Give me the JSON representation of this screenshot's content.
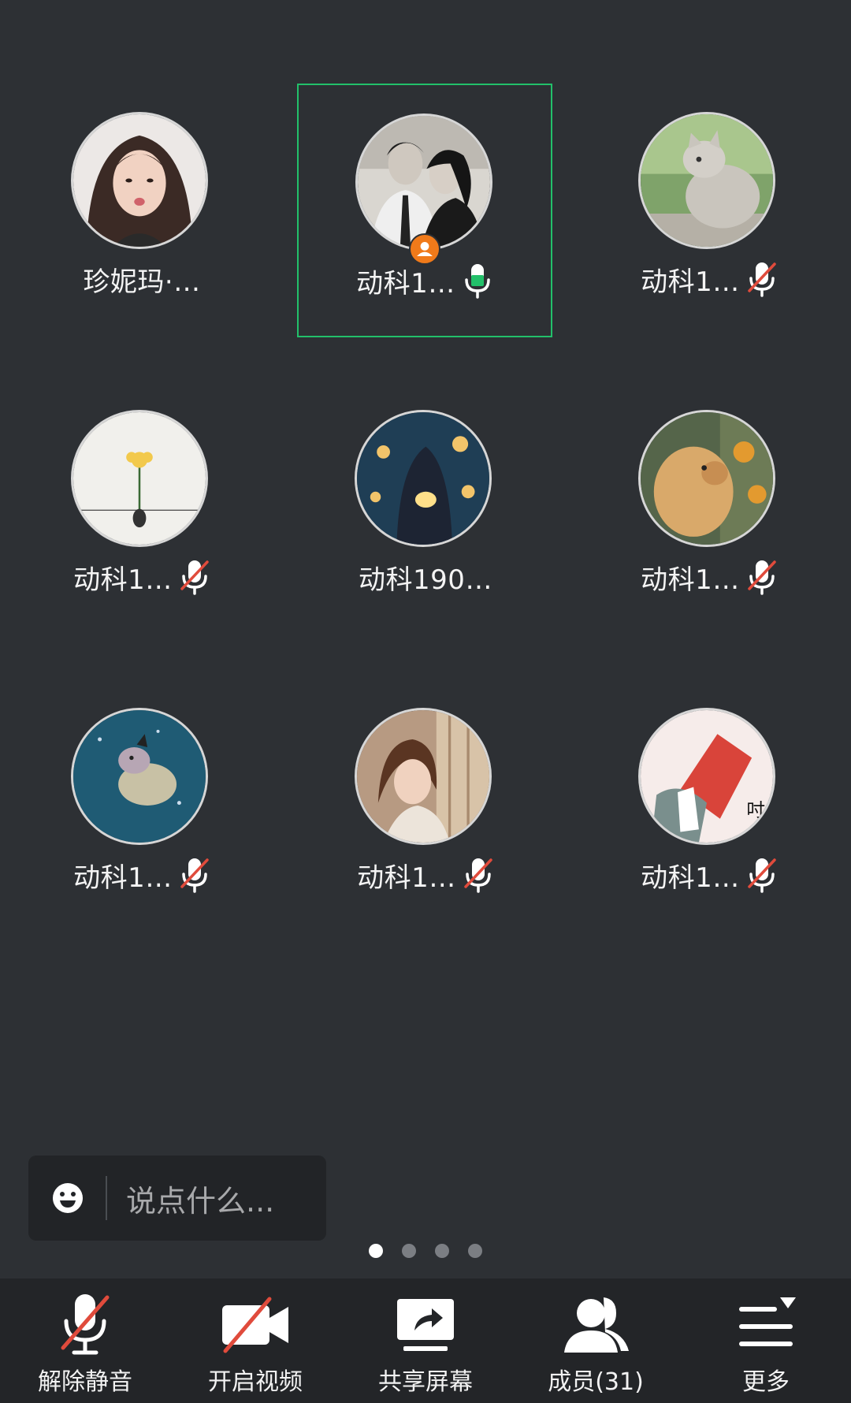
{
  "participants": [
    {
      "name": "珍妮玛·…",
      "mic": "none",
      "host": false,
      "active": false,
      "avatar_icon": "girl-portrait-avatar"
    },
    {
      "name": "动科1…",
      "mic": "on",
      "host": true,
      "active": true,
      "avatar_icon": "couple-bw-photo-avatar"
    },
    {
      "name": "动科1…",
      "mic": "muted",
      "host": false,
      "active": false,
      "avatar_icon": "cat-photo-avatar"
    },
    {
      "name": "动科1…",
      "mic": "muted",
      "host": false,
      "active": false,
      "avatar_icon": "flower-sketch-avatar"
    },
    {
      "name": "动科190…",
      "mic": "none",
      "host": false,
      "active": false,
      "avatar_icon": "anime-lanterns-avatar"
    },
    {
      "name": "动科1…",
      "mic": "muted",
      "host": false,
      "active": false,
      "avatar_icon": "puppy-photo-avatar"
    },
    {
      "name": "动科1…",
      "mic": "muted",
      "host": false,
      "active": false,
      "avatar_icon": "cartoon-hamster-avatar"
    },
    {
      "name": "动科1…",
      "mic": "muted",
      "host": false,
      "active": false,
      "avatar_icon": "girl-window-avatar"
    },
    {
      "name": "动科1…",
      "mic": "muted",
      "host": false,
      "active": false,
      "avatar_icon": "snack-bag-cartoon-avatar"
    }
  ],
  "chat": {
    "placeholder": "说点什么...",
    "icon": "emoji-icon"
  },
  "pager": {
    "pages": 4,
    "current": 1
  },
  "toolbar": {
    "unmute_label": "解除静音",
    "video_label": "开启视频",
    "share_label": "共享屏幕",
    "members_label": "成员(31)",
    "more_label": "更多"
  },
  "colors": {
    "background": "#2d3034",
    "active_border": "#22c06a",
    "mic_on": "#22c06a",
    "mute_slash": "#e04b3c",
    "host_badge": "#f07a1a"
  }
}
